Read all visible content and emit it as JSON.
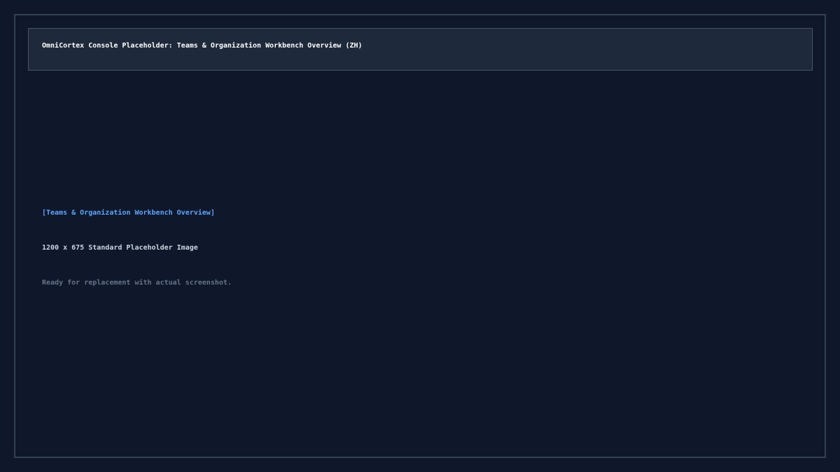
{
  "header": {
    "title": "OmniCortex Console Placeholder: Teams & Organization Workbench Overview (ZH)"
  },
  "placeholder": {
    "section_label": "[Teams & Organization Workbench Overview]",
    "dimensions_text": "1200 x 675 Standard Placeholder Image",
    "status_text": "Ready for replacement with actual screenshot."
  },
  "colors": {
    "background": "#0f172a",
    "frame_border": "#334155",
    "header_background": "#1e293b",
    "header_border": "#475569",
    "accent": "#60a5fa",
    "text_primary": "#ffffff",
    "text_secondary": "#cbd5e1",
    "text_muted": "#64748b"
  }
}
